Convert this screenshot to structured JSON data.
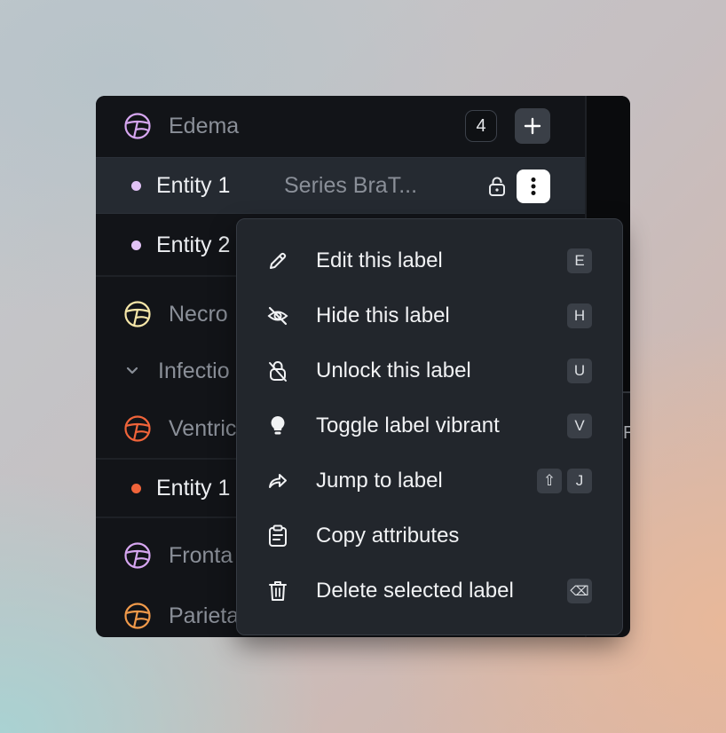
{
  "sidebar": {
    "groups": [
      {
        "label": "Edema",
        "icon": "brain-region-icon",
        "color": "#d6a6f0",
        "count": "4"
      },
      {
        "label": "Necro",
        "icon": "brain-region-icon",
        "color": "#f5e6a8"
      },
      {
        "label": "Infectio",
        "icon": "chevron-down-icon"
      },
      {
        "label": "Ventric",
        "icon": "brain-region-icon",
        "color": "#f0643a"
      },
      {
        "label": "Fronta",
        "icon": "brain-region-icon",
        "color": "#d6a6f0"
      },
      {
        "label": "Parieta",
        "icon": "brain-region-icon",
        "color": "#f09a4a"
      }
    ],
    "entities": [
      {
        "label": "Entity 1",
        "series": "Series BraT...",
        "dot_color": "#e1c2f5"
      },
      {
        "label": "Entity 2",
        "dot_color": "#e1c2f5"
      },
      {
        "label": "Entity 1",
        "dot_color": "#f0643a"
      }
    ]
  },
  "right_fragment": "R",
  "context_menu": {
    "items": [
      {
        "label": "Edit this label",
        "icon": "pencil-icon",
        "shortcut": "E"
      },
      {
        "label": "Hide this label",
        "icon": "eye-off-icon",
        "shortcut": "H"
      },
      {
        "label": "Unlock this label",
        "icon": "unlock-icon",
        "shortcut": "U"
      },
      {
        "label": "Toggle label vibrant",
        "icon": "lightbulb-icon",
        "shortcut": "V"
      },
      {
        "label": "Jump to label",
        "icon": "share-arrow-icon",
        "shortcut_modifier": "⇧",
        "shortcut": "J"
      },
      {
        "label": "Copy attributes",
        "icon": "clipboard-icon"
      },
      {
        "label": "Delete selected label",
        "icon": "trash-icon",
        "shortcut": "⌫"
      }
    ]
  }
}
